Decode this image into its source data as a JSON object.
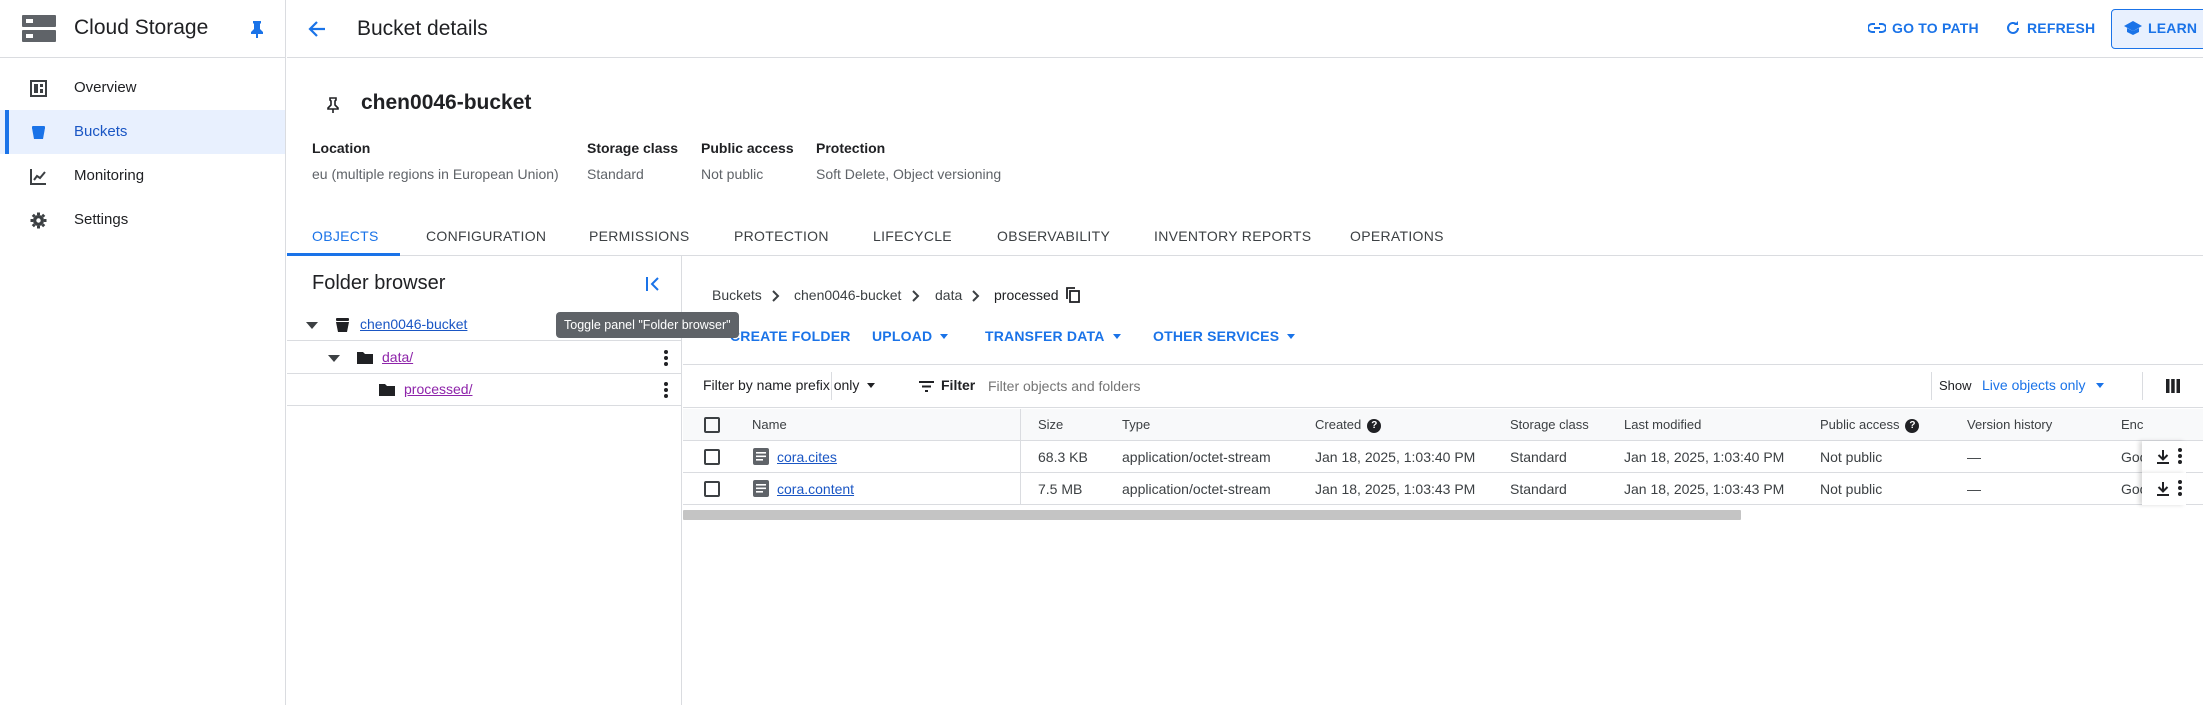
{
  "sidebar": {
    "title": "Cloud Storage",
    "items": [
      {
        "label": "Overview",
        "icon": "dashboard-icon"
      },
      {
        "label": "Buckets",
        "icon": "bucket-icon",
        "active": true
      },
      {
        "label": "Monitoring",
        "icon": "chart-icon"
      },
      {
        "label": "Settings",
        "icon": "gear-icon"
      }
    ]
  },
  "header": {
    "title": "Bucket details",
    "go_to_path": "GO TO PATH",
    "refresh": "REFRESH",
    "learn": "LEARN"
  },
  "bucket": {
    "name": "chen0046-bucket",
    "info": [
      {
        "label": "Location",
        "value": "eu (multiple regions in European Union)"
      },
      {
        "label": "Storage class",
        "value": "Standard"
      },
      {
        "label": "Public access",
        "value": "Not public"
      },
      {
        "label": "Protection",
        "value": "Soft Delete, Object versioning"
      }
    ]
  },
  "tabs": [
    "OBJECTS",
    "CONFIGURATION",
    "PERMISSIONS",
    "PROTECTION",
    "LIFECYCLE",
    "OBSERVABILITY",
    "INVENTORY REPORTS",
    "OPERATIONS"
  ],
  "folder_browser": {
    "title": "Folder browser",
    "tooltip": "Toggle panel \"Folder browser\"",
    "tree": [
      "chen0046-bucket",
      "data/",
      "processed/"
    ]
  },
  "breadcrumb": [
    "Buckets",
    "chen0046-bucket",
    "data",
    "processed"
  ],
  "actions": [
    "CREATE FOLDER",
    "UPLOAD",
    "TRANSFER DATA",
    "OTHER SERVICES"
  ],
  "filter": {
    "prefix_mode": "Filter by name prefix only",
    "label": "Filter",
    "placeholder": "Filter objects and folders",
    "show_label": "Show",
    "show_value": "Live objects only"
  },
  "table": {
    "columns": [
      "Name",
      "Size",
      "Type",
      "Created",
      "Storage class",
      "Last modified",
      "Public access",
      "Version history",
      "Enc"
    ],
    "rows": [
      {
        "name": "cora.cites",
        "size": "68.3 KB",
        "type": "application/octet-stream",
        "created": "Jan 18, 2025, 1:03:40 PM",
        "storage_class": "Standard",
        "last_modified": "Jan 18, 2025, 1:03:40 PM",
        "public_access": "Not public",
        "version_history": "—",
        "encryption": "Goo"
      },
      {
        "name": "cora.content",
        "size": "7.5 MB",
        "type": "application/octet-stream",
        "created": "Jan 18, 2025, 1:03:43 PM",
        "storage_class": "Standard",
        "last_modified": "Jan 18, 2025, 1:03:43 PM",
        "public_access": "Not public",
        "version_history": "—",
        "encryption": "Goo"
      }
    ]
  },
  "colors": {
    "accent": "#1a73e8",
    "active_bg": "#e8f0fe",
    "visited_link": "#8e24aa"
  }
}
